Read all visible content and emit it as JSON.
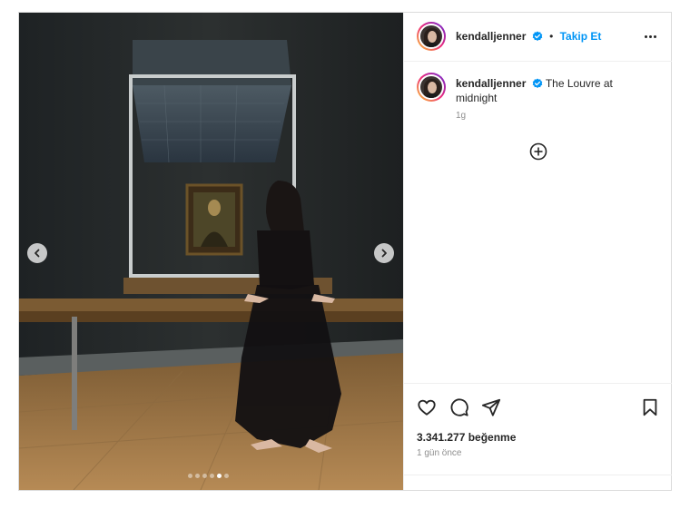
{
  "post": {
    "username": "kendalljenner",
    "follow_label": "Takip Et",
    "separator": "•",
    "caption": "The Louvre at midnight",
    "caption_age": "1g",
    "likes": "3.341.277 beğenme",
    "timestamp": "1 gün önce",
    "carousel": {
      "count": 6,
      "active_index": 4
    }
  },
  "colors": {
    "accent": "#0095f6",
    "verified": "#0095f6"
  },
  "icons": {
    "more": "more-options-icon",
    "add_comment": "plus-circle-icon",
    "like": "heart-icon",
    "comment": "comment-icon",
    "share": "share-icon",
    "save": "bookmark-icon",
    "prev": "chevron-left-icon",
    "next": "chevron-right-icon"
  }
}
